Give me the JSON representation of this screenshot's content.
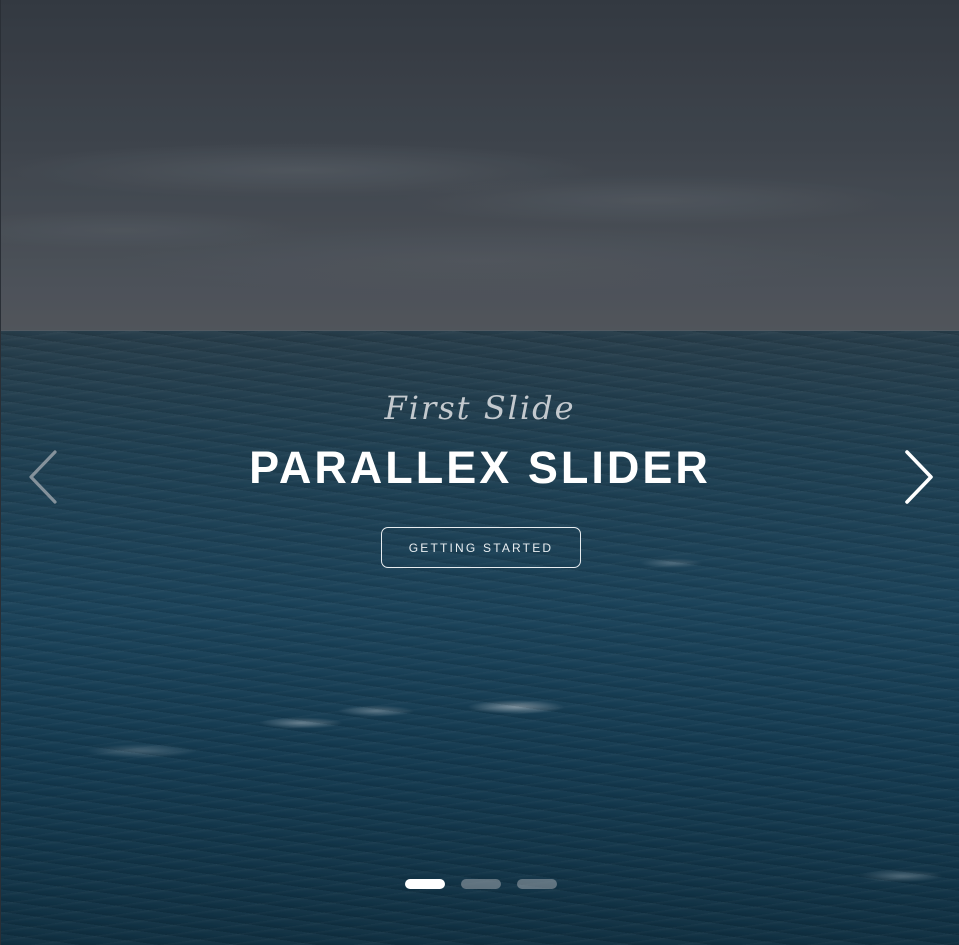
{
  "slider": {
    "subtitle": "First Slide",
    "title": "PARALLEX SLIDER",
    "cta_label": "GETTING STARTED",
    "prev_icon": "chevron-left-icon",
    "next_icon": "chevron-right-icon",
    "indicators": [
      {
        "active": true
      },
      {
        "active": false
      },
      {
        "active": false
      }
    ],
    "colors": {
      "title": "#ffffff",
      "subtitle": "#c3c9ce",
      "indicator_active": "#ffffff",
      "indicator_inactive": "#8f979d",
      "sky": "#464c54",
      "sea": "#1e4a63"
    }
  }
}
